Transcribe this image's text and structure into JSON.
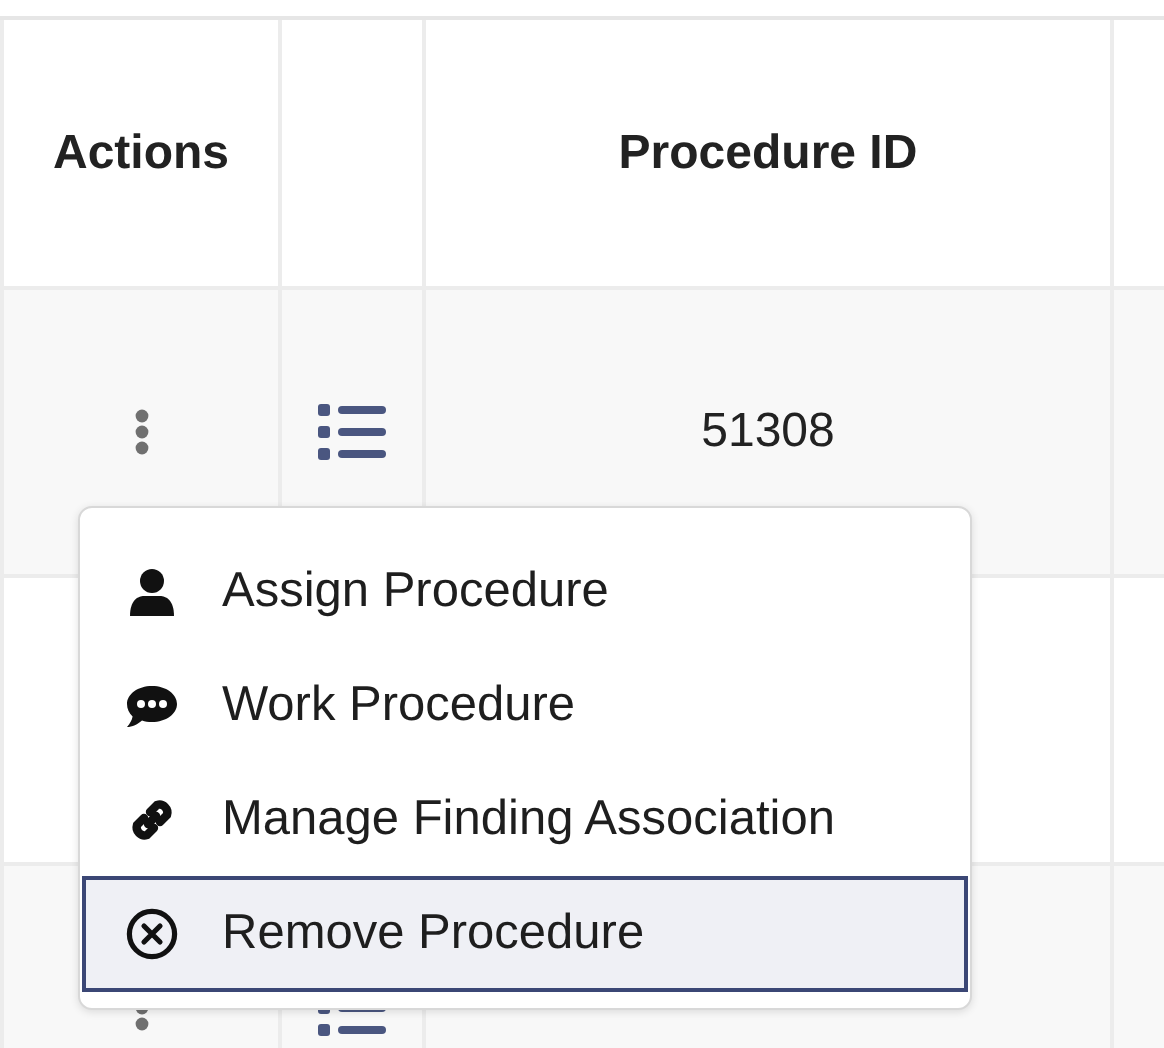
{
  "table": {
    "columns": [
      "Actions",
      "Procedure ID"
    ],
    "rows": [
      {
        "procedure_id": "51308"
      },
      {}
    ]
  },
  "menu": {
    "items": [
      {
        "kind": "person",
        "label": "Assign Procedure",
        "selected": false
      },
      {
        "kind": "comment",
        "label": "Work Procedure",
        "selected": false
      },
      {
        "kind": "link",
        "label": "Manage Finding Association",
        "selected": false
      },
      {
        "kind": "remove",
        "label": "Remove Procedure",
        "selected": true
      }
    ]
  }
}
